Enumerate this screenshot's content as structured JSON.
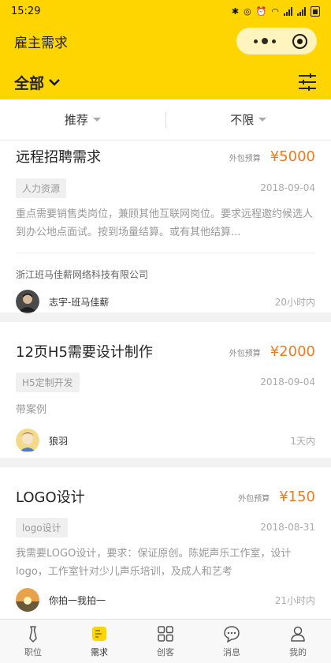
{
  "status": {
    "time": "15:29"
  },
  "titlebar": {
    "title": "雇主需求"
  },
  "filter": {
    "category": "全部"
  },
  "sort": {
    "left": "推荐",
    "right": "不限"
  },
  "cards": [
    {
      "title": "远程招聘需求",
      "budget_label": "外包预算",
      "budget": "¥5000",
      "tag": "人力资源",
      "date": "2018-09-04",
      "desc": "重点需要销售类岗位，兼顾其他互联网岗位。要求远程邀约候选人到办公地点面试。按到场量结算。或有其他结算...",
      "company": "浙江班马佳薪网络科技有限公司",
      "author": "志宇-班马佳薪",
      "time_ago": "20小时内"
    },
    {
      "title": "12页H5需要设计制作",
      "budget_label": "外包预算",
      "budget": "¥2000",
      "tag": "H5定制开发",
      "date": "2018-09-04",
      "desc": "带案例",
      "author": "狼羽",
      "time_ago": "1天内"
    },
    {
      "title": "LOGO设计",
      "budget_label": "外包预算",
      "budget": "¥150",
      "tag": "logo设计",
      "date": "2018-08-31",
      "desc": "我需要LOGO设计，要求：保证原创。陈妮声乐工作室，设计logo，工作室针对少儿声乐培训，及成人和艺考",
      "author": "你拍一我拍一",
      "time_ago": "21小时内"
    }
  ],
  "tabbar": {
    "items": [
      {
        "label": "职位",
        "icon": "tie-icon"
      },
      {
        "label": "需求",
        "icon": "demand-icon"
      },
      {
        "label": "创客",
        "icon": "grid-icon"
      },
      {
        "label": "消息",
        "icon": "chat-icon"
      },
      {
        "label": "我的",
        "icon": "user-icon"
      }
    ],
    "active_index": 1
  },
  "colors": {
    "brand": "#ffd500",
    "price": "#f07b1d"
  }
}
